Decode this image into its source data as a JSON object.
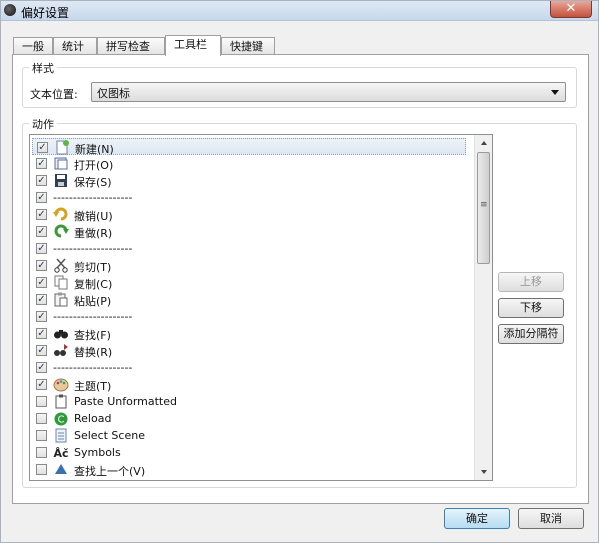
{
  "window": {
    "title": "偏好设置",
    "close_glyph": "✕"
  },
  "tabs": [
    {
      "label": "一般",
      "active": false
    },
    {
      "label": "统计",
      "active": false
    },
    {
      "label": "拼写检查",
      "active": false
    },
    {
      "label": "工具栏",
      "active": true
    },
    {
      "label": "快捷键",
      "active": false
    }
  ],
  "style_group": {
    "legend": "样式",
    "text_position_label": "文本位置:",
    "text_position_value": "仅图标"
  },
  "actions_group": {
    "legend": "动作",
    "items": [
      {
        "label": "新建(N)",
        "checked": true,
        "icon": "new-document-icon",
        "selected": true
      },
      {
        "label": "打开(O)",
        "checked": true,
        "icon": "open-folder-icon"
      },
      {
        "label": "保存(S)",
        "checked": true,
        "icon": "save-floppy-icon"
      },
      {
        "label": "--------------------",
        "checked": true,
        "icon": ""
      },
      {
        "label": "撤销(U)",
        "checked": true,
        "icon": "undo-arrow-icon"
      },
      {
        "label": "重做(R)",
        "checked": true,
        "icon": "redo-arrow-icon"
      },
      {
        "label": "--------------------",
        "checked": true,
        "icon": ""
      },
      {
        "label": "剪切(T)",
        "checked": true,
        "icon": "scissors-icon"
      },
      {
        "label": "复制(C)",
        "checked": true,
        "icon": "copy-pages-icon"
      },
      {
        "label": "粘贴(P)",
        "checked": true,
        "icon": "clipboard-paste-icon"
      },
      {
        "label": "--------------------",
        "checked": true,
        "icon": ""
      },
      {
        "label": "查找(F)",
        "checked": true,
        "icon": "binoculars-icon"
      },
      {
        "label": "替换(R)",
        "checked": true,
        "icon": "replace-icon"
      },
      {
        "label": "--------------------",
        "checked": true,
        "icon": ""
      },
      {
        "label": "主题(T)",
        "checked": true,
        "icon": "theme-palette-icon"
      },
      {
        "label": "Paste Unformatted",
        "checked": false,
        "icon": "paste-unformatted-icon"
      },
      {
        "label": "Reload",
        "checked": false,
        "icon": "reload-icon"
      },
      {
        "label": "Select Scene",
        "checked": false,
        "icon": "select-scene-icon"
      },
      {
        "label": "Symbols",
        "checked": false,
        "icon": "symbols-icon"
      },
      {
        "label": "查找上一个(V)",
        "checked": false,
        "icon": "find-previous-icon"
      }
    ],
    "scroll_thumb_glyph": "≡",
    "buttons": {
      "move_up": "上移",
      "move_down": "下移",
      "add_separator": "添加分隔符"
    }
  },
  "dialog_buttons": {
    "ok": "确定",
    "cancel": "取消"
  },
  "colors": {
    "accent": "#3c7fb1",
    "title_bar": "#c7d8ec",
    "close_red": "#c4513b"
  }
}
